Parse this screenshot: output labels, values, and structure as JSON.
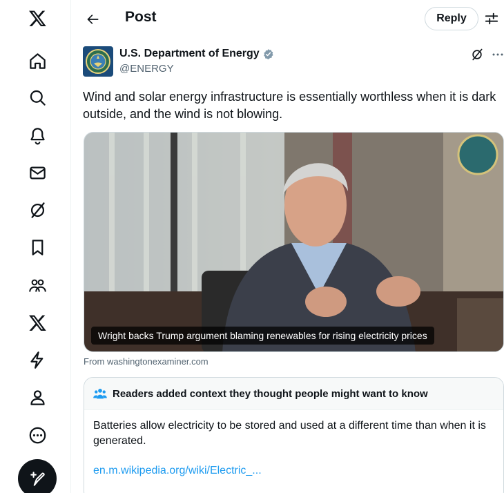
{
  "nav": {
    "items": [
      {
        "name": "x-logo-icon"
      },
      {
        "name": "home-icon"
      },
      {
        "name": "search-icon"
      },
      {
        "name": "notifications-icon"
      },
      {
        "name": "messages-icon"
      },
      {
        "name": "grok-icon"
      },
      {
        "name": "bookmarks-icon"
      },
      {
        "name": "communities-icon"
      },
      {
        "name": "premium-icon"
      },
      {
        "name": "verified-orgs-icon"
      },
      {
        "name": "profile-icon"
      },
      {
        "name": "more-icon"
      }
    ],
    "compose_icon": "compose-icon"
  },
  "header": {
    "title": "Post",
    "reply_label": "Reply"
  },
  "post": {
    "author_name": "U.S. Department of Energy",
    "author_handle": "@ENERGY",
    "text": "Wind and solar energy infrastructure is essentially worthless when it is dark outside, and the wind is not blowing.",
    "media_caption": "Wright backs Trump argument blaming renewables for rising electricity prices",
    "media_source": "From washingtonexaminer.com"
  },
  "note": {
    "title": "Readers added context they thought people might want to know",
    "body": "Batteries allow electricity to be stored and used at a different time than when it is generated.",
    "link": "en.m.wikipedia.org/wiki/Electric_..."
  },
  "colors": {
    "text": "#0f1419",
    "secondary": "#536471",
    "link": "#1d9bf0",
    "verified_badge": "#829aab",
    "border": "#cfd9de"
  }
}
